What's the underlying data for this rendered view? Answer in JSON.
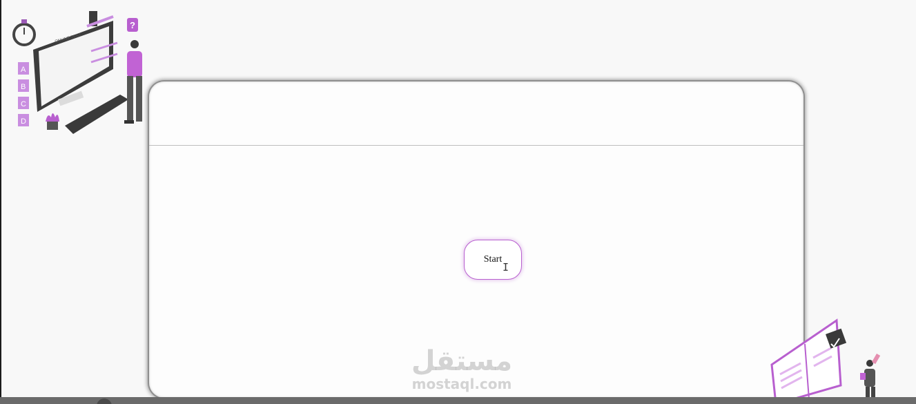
{
  "header": {
    "title": ""
  },
  "main": {
    "start_label": "Start"
  },
  "illustration_top_left": {
    "screen_heading": "ONLINE TEST",
    "options": [
      "A",
      "B",
      "C",
      "D"
    ],
    "badge": "?"
  },
  "watermark": {
    "arabic": "مستقل",
    "latin": "mostaql.com"
  },
  "colors": {
    "accent": "#b85fcf",
    "card_border": "#8f8f8f",
    "background": "#f8f8f8"
  }
}
